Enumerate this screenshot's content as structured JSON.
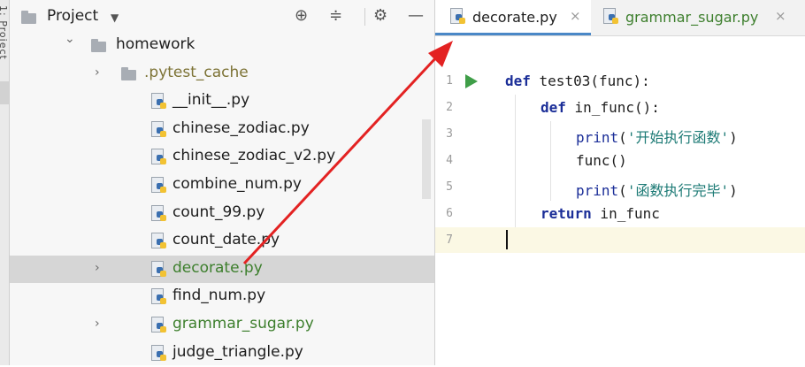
{
  "left_strip": {
    "label": "1: Project"
  },
  "project_panel": {
    "title": "Project",
    "icons": [
      "target-icon",
      "collapse-icon",
      "gear-icon",
      "minimize-icon"
    ]
  },
  "tree": [
    {
      "label": "homework",
      "type": "folder",
      "expanded": true,
      "style": "normal"
    },
    {
      "label": ".pytest_cache",
      "type": "folder",
      "expanded": false,
      "style": "olive"
    },
    {
      "label": "__init__.py",
      "type": "file",
      "style": "normal"
    },
    {
      "label": "chinese_zodiac.py",
      "type": "file",
      "style": "normal"
    },
    {
      "label": "chinese_zodiac_v2.py",
      "type": "file",
      "style": "normal"
    },
    {
      "label": "combine_num.py",
      "type": "file",
      "style": "normal"
    },
    {
      "label": "count_99.py",
      "type": "file",
      "style": "normal"
    },
    {
      "label": "count_date.py",
      "type": "file",
      "style": "normal"
    },
    {
      "label": "decorate.py",
      "type": "file",
      "expandable": true,
      "style": "green",
      "selected": true
    },
    {
      "label": "find_num.py",
      "type": "file",
      "style": "normal"
    },
    {
      "label": "grammar_sugar.py",
      "type": "file",
      "expandable": true,
      "style": "green"
    },
    {
      "label": "judge_triangle.py",
      "type": "file",
      "style": "normal"
    }
  ],
  "tabs": [
    {
      "label": "decorate.py",
      "active": true,
      "close": "×"
    },
    {
      "label": "grammar_sugar.py",
      "active": false,
      "close": "×"
    }
  ],
  "code": {
    "line_numbers": [
      "1",
      "2",
      "3",
      "4",
      "5",
      "6",
      "7"
    ],
    "line1": {
      "kw": "def",
      "rest": " test03(func):"
    },
    "line2": {
      "kw": "def",
      "rest": " in_func():"
    },
    "line3": {
      "fn": "print",
      "open": "(",
      "str": "'开始执行函数'",
      "close": ")"
    },
    "line4": {
      "text": "func()"
    },
    "line5": {
      "fn": "print",
      "open": "(",
      "str": "'函数执行完毕'",
      "close": ")"
    },
    "line6": {
      "kw": "return",
      "rest": " in_func"
    }
  },
  "colors": {
    "arrow": "#e32222",
    "accent": "#4a88c7",
    "green_file": "#3d7f2d",
    "keyword": "#1b2e98",
    "string": "#1c7a75"
  }
}
